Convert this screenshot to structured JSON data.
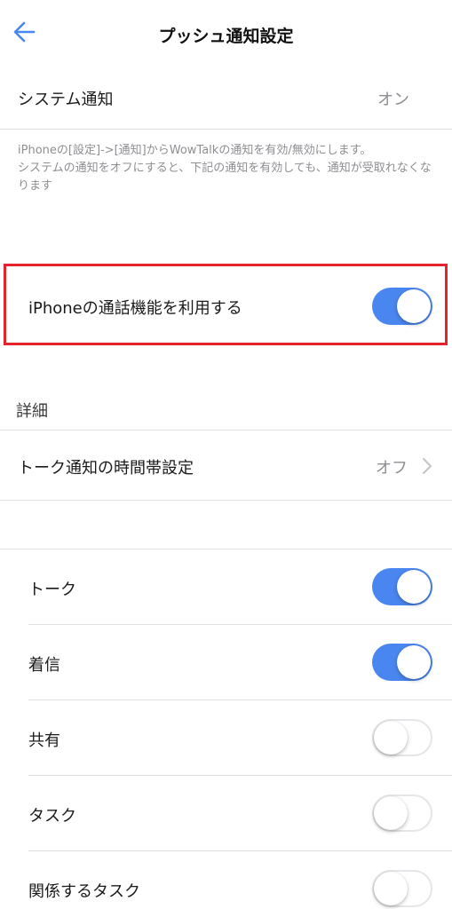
{
  "nav": {
    "title": "プッシュ通知設定",
    "back_icon": "arrow-left-icon"
  },
  "system": {
    "label": "システム通知",
    "value": "オン"
  },
  "note": {
    "line1": "iPhoneの[設定]->[通知]からWowTalkの通知を有効/無効にします。",
    "line2": "システムの通知をオフにすると、下記の通知を有効しても、通知が受取れなくなります"
  },
  "call": {
    "label": "iPhoneの通話機能を利用する",
    "enabled": true
  },
  "details": {
    "header": "詳細",
    "timeband": {
      "label": "トーク通知の時間帯設定",
      "value": "オフ"
    }
  },
  "items": [
    {
      "label": "トーク",
      "enabled": true
    },
    {
      "label": "着信",
      "enabled": true
    },
    {
      "label": "共有",
      "enabled": false
    },
    {
      "label": "タスク",
      "enabled": false
    },
    {
      "label": "関係するタスク",
      "enabled": false
    }
  ],
  "colors": {
    "toggle_on": "#4a86ef",
    "highlight": "#e5232d",
    "back_arrow": "#4a86ef"
  }
}
